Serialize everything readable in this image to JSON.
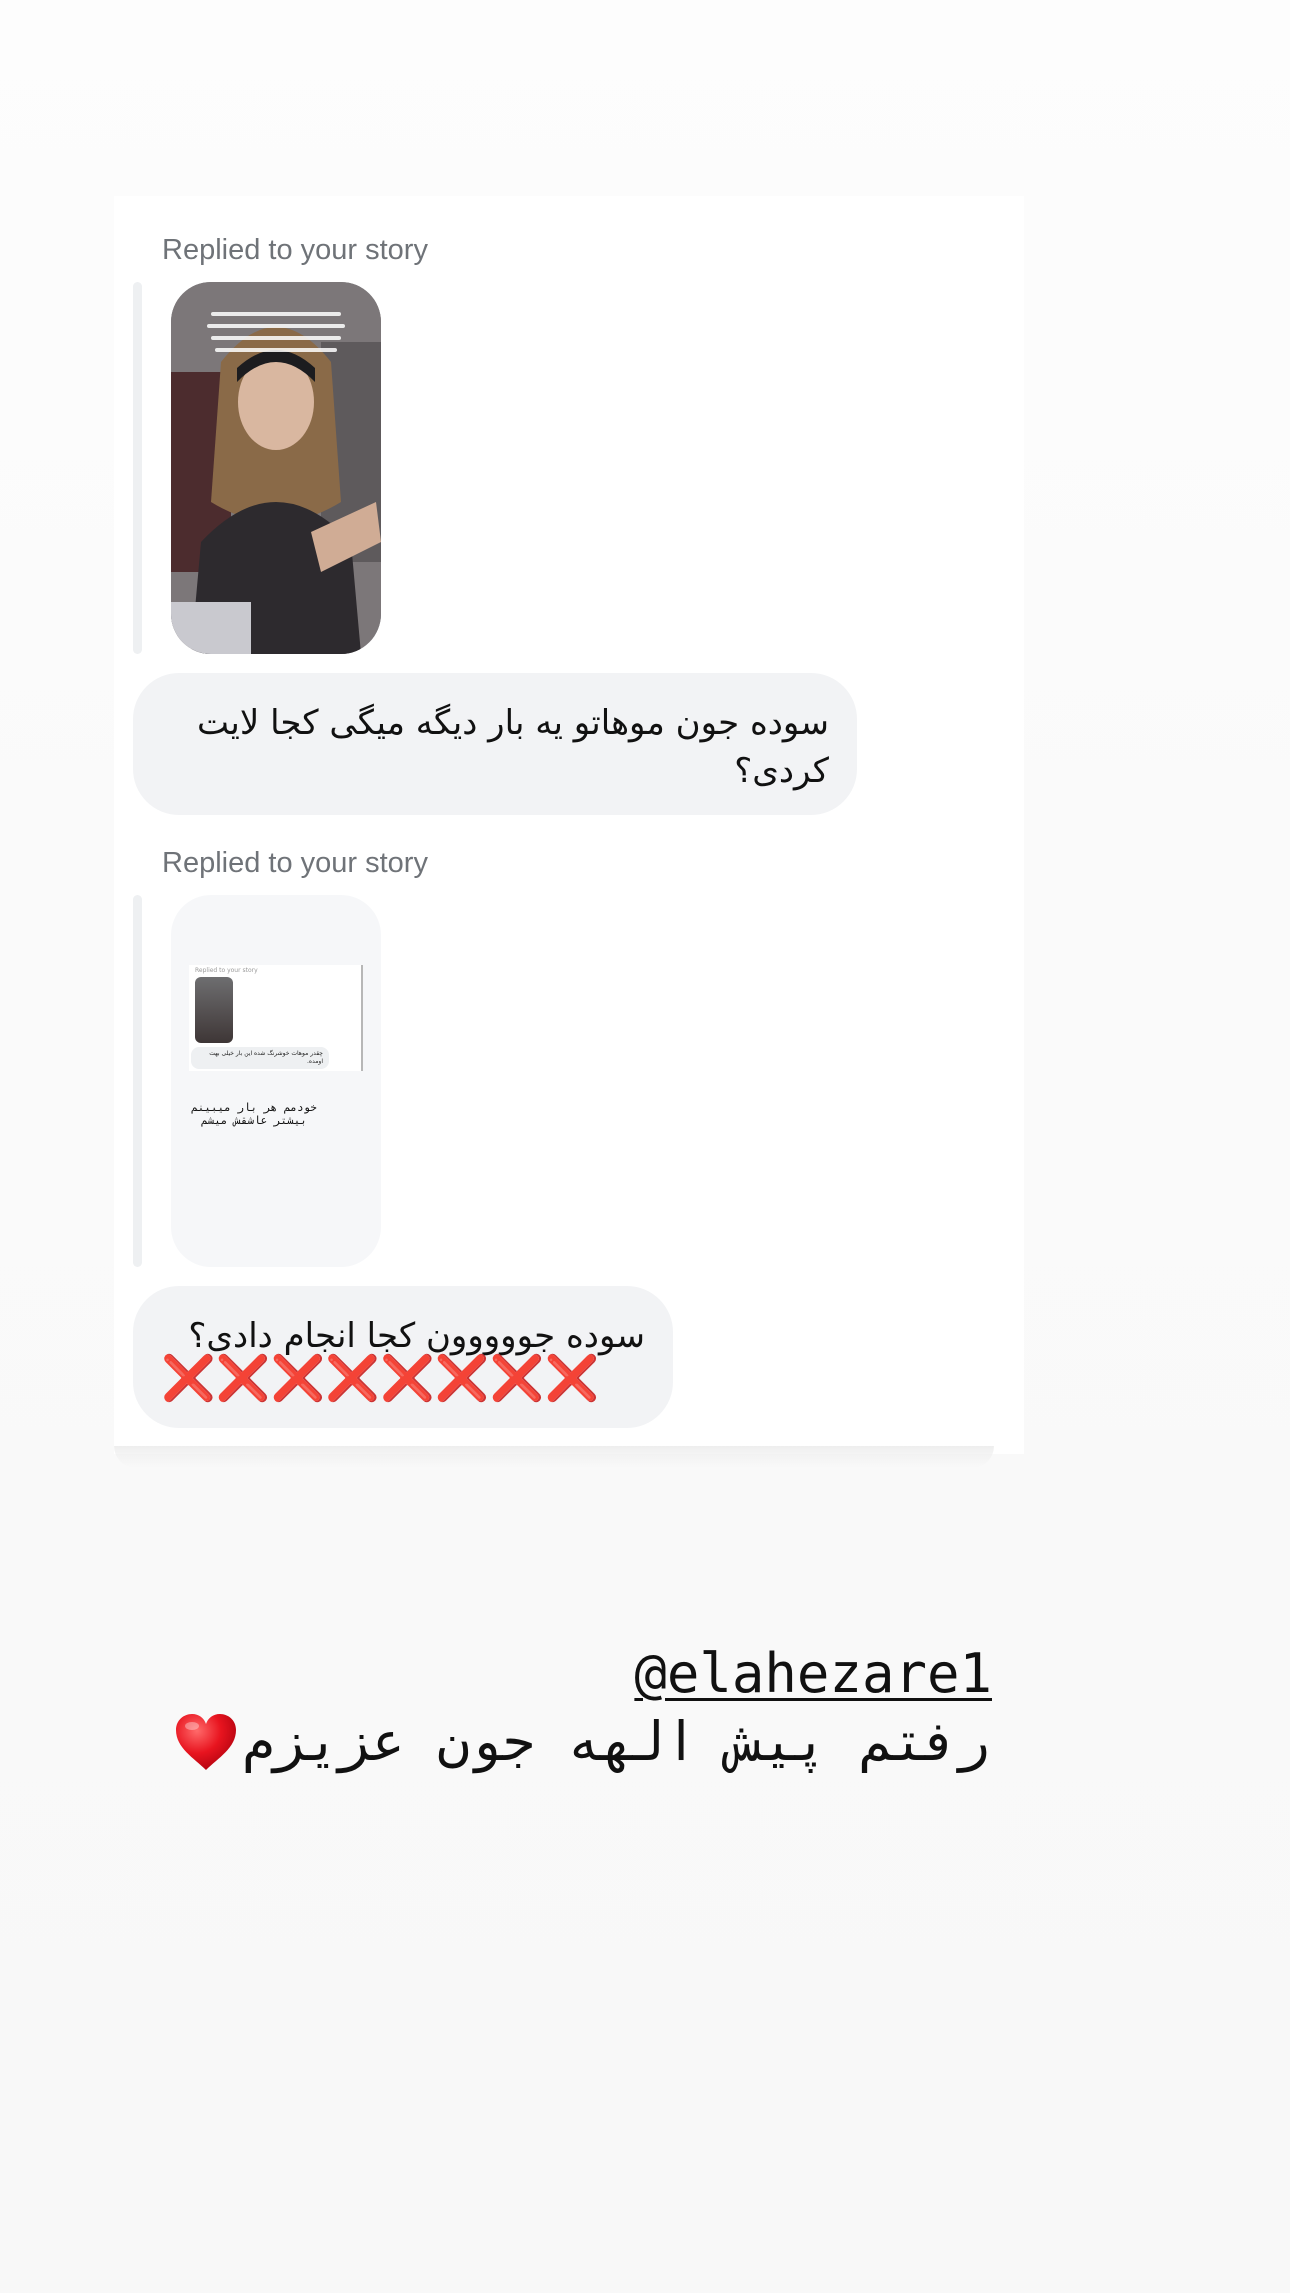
{
  "conversation": {
    "messages": [
      {
        "reply_label": "Replied to your story",
        "story_overlay_text": "سلام عزیزان صبح\nروز دوشنبه بخیر باشه\nشنیدم تولد ها غلطن\nمرسی که زنگ شدن",
        "text": "سوده جون موهاتو یه بار دیگه میگی کجا لایت کردی؟"
      },
      {
        "reply_label": "Replied to your story",
        "story_screenshot": {
          "label": "Replied to your story",
          "bubble_text": "چقدر موهات خوشرنگ شده این بار خیلی بهت اومده.",
          "caption": "خودمم هر بار میبینم بیشتر عاشقش میشم"
        },
        "text": "سوده جووووون کجا انجام دادی؟",
        "marks": "❌❌❌❌❌❌❌❌"
      }
    ]
  },
  "story_footer": {
    "mention": "@elahezare1",
    "caption": "رفتم پیش الهه جون عزیزم",
    "heart_icon": "red-heart",
    "heart_color": "#e8141f"
  },
  "colors": {
    "bubble_background": "#f2f3f5",
    "label_gray": "#6f7378",
    "x_mark_red": "#e3101f"
  }
}
